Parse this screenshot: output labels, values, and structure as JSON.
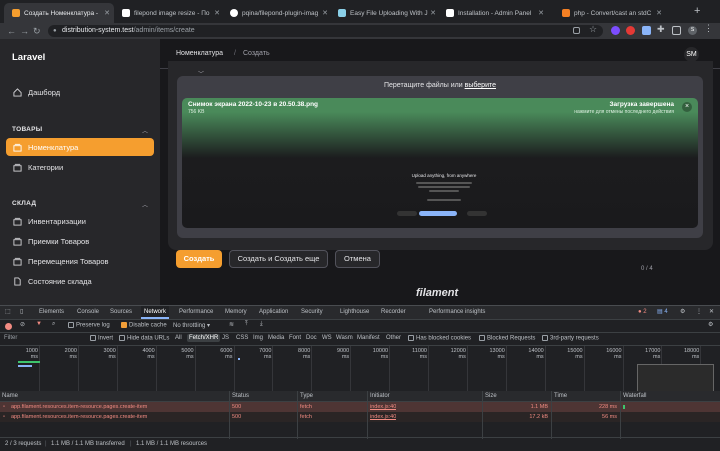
{
  "browser": {
    "tabs": [
      {
        "label": "Создать Номенклатура -",
        "active": true,
        "favicon_color": "#f59e2f"
      },
      {
        "label": "filepond image resize - По",
        "active": false,
        "favicon_color": "#ffffff"
      },
      {
        "label": "pqina/filepond-plugin-imag",
        "active": false,
        "favicon_color": "#ffffff"
      },
      {
        "label": "Easy File Uploading With J",
        "active": false,
        "favicon_color": "#8ad0e8"
      },
      {
        "label": "Installation - Admin Panel",
        "active": false,
        "favicon_color": "#ffffff"
      },
      {
        "label": "php - Convert/cast an stdC",
        "active": false,
        "favicon_color": "#f48024"
      }
    ],
    "new_tab_label": "+",
    "url_host": "distribution-system.test",
    "url_path": "/admin/items/create"
  },
  "app": {
    "brand": "Laravel",
    "sidebar": {
      "dashboard": "Дашборд",
      "groups": [
        {
          "title": "ТОВАРЫ",
          "items": [
            {
              "label": "Номенклатура",
              "active": true
            },
            {
              "label": "Категории",
              "active": false
            }
          ]
        },
        {
          "title": "СКЛАД",
          "items": [
            {
              "label": "Инвентаризации"
            },
            {
              "label": "Приемки Товаров"
            },
            {
              "label": "Перемещения Товаров"
            },
            {
              "label": "Состояние склада"
            }
          ]
        }
      ]
    },
    "breadcrumb": {
      "parent": "Номенклатура",
      "separator": "/",
      "current": "Создать"
    },
    "avatar": "SM",
    "upload": {
      "drop_text": "Перетащите файлы или",
      "drop_link": "выберите",
      "file_name": "Снимок экрана 2022-10-23 в 20.50.38.png",
      "file_size": "756 KB",
      "status": "Загрузка завершена",
      "hint": "нажмите для отмены последнего действия",
      "close_icon": "×",
      "preview_title": "Upload anything, from anywhere",
      "counter": "0 / 4"
    },
    "buttons": {
      "create": "Создать",
      "create_another": "Создать и Создать еще",
      "cancel": "Отмена"
    },
    "footer_logo": "filament"
  },
  "devtools": {
    "tabs": [
      "Elements",
      "Console",
      "Sources",
      "Network",
      "Performance",
      "Memory",
      "Application",
      "Security",
      "Lighthouse",
      "Recorder",
      "Performance insights"
    ],
    "active_tab": "Network",
    "error_count": "2",
    "message_count": "4",
    "toolbar": {
      "preserve_log": "Preserve log",
      "disable_cache": "Disable cache",
      "throttling": "No throttling"
    },
    "filter": {
      "placeholder": "Filter",
      "invert": "Invert",
      "hide_data_urls": "Hide data URLs",
      "types": [
        "All",
        "Fetch/XHR",
        "JS",
        "CSS",
        "Img",
        "Media",
        "Font",
        "Doc",
        "WS",
        "Wasm",
        "Manifest",
        "Other"
      ],
      "active_type": "Fetch/XHR",
      "blocked_cookies": "Has blocked cookies",
      "blocked_requests": "Blocked Requests",
      "third_party": "3rd-party requests"
    },
    "timeline_ticks": [
      "1000 ms",
      "2000 ms",
      "3000 ms",
      "4000 ms",
      "5000 ms",
      "6000 ms",
      "7000 ms",
      "8000 ms",
      "9000 ms",
      "10000 ms",
      "11000 ms",
      "12000 ms",
      "13000 ms",
      "14000 ms",
      "15000 ms",
      "16000 ms",
      "17000 ms",
      "18000 ms"
    ],
    "columns": [
      "Name",
      "Status",
      "Type",
      "Initiator",
      "Size",
      "Time",
      "Waterfall"
    ],
    "rows": [
      {
        "name": "app.filament.resources.item-resource.pages.create-item",
        "status": "500",
        "type": "fetch",
        "initiator": "index.js:40",
        "size": "1.1 MB",
        "time": "228 ms"
      },
      {
        "name": "app.filament.resources.item-resource.pages.create-item",
        "status": "500",
        "type": "fetch",
        "initiator": "index.js:40",
        "size": "17.2 kB",
        "time": "56 ms"
      }
    ],
    "status": {
      "requests": "2 / 3 requests",
      "transferred": "1.1 MB / 1.1 MB transferred",
      "resources": "1.1 MB / 1.1 MB resources"
    }
  }
}
